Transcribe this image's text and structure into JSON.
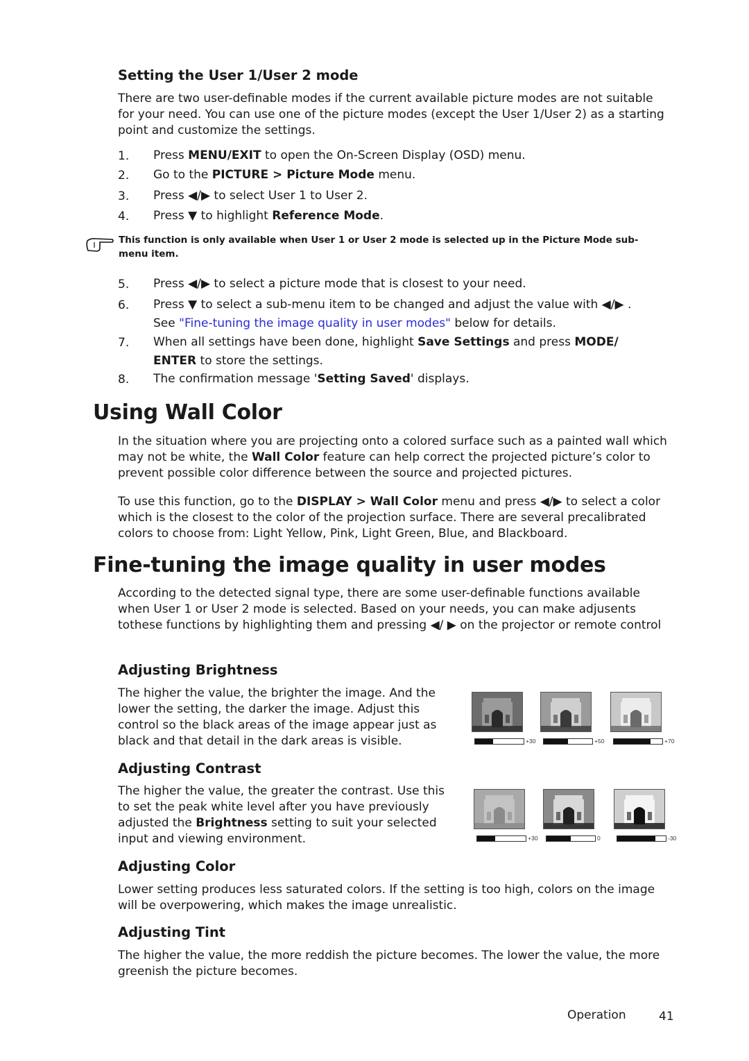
{
  "section1": {
    "heading": "Setting the User 1/User 2 mode",
    "intro": "There are two user-definable modes if the current available picture modes are not suitable for your need. You can use one of the picture modes (except the User 1/User 2) as a starting point and customize the settings.",
    "steps_a": [
      {
        "n": "1.",
        "pre": "Press ",
        "b1": "MENU/EXIT",
        "post": " to open the On-Screen Display (OSD) menu."
      },
      {
        "n": "2.",
        "pre": "Go to the ",
        "b1": "PICTURE > Picture Mode",
        "post": " menu."
      },
      {
        "n": "3.",
        "pre": "Press ◀/▶  to select User 1 to User 2.",
        "b1": "",
        "post": ""
      },
      {
        "n": "4.",
        "pre": "Press ▼  to highlight ",
        "b1": "Reference Mode",
        "post": "."
      }
    ],
    "note": "This function is only available when User 1 or User 2 mode is selected up in the Picture Mode sub-menu item.",
    "steps_b": [
      {
        "n": "5.",
        "text": "Press ◀/▶  to select a picture mode that is closest to your need."
      },
      {
        "n": "6.",
        "text": "Press ▼  to select a sub-menu item to be changed and adjust the value with ◀/▶ .",
        "see_pre": "See ",
        "see_link": "\"Fine-tuning the image quality in user modes\"",
        "see_post": " below for details."
      },
      {
        "n": "7.",
        "pre": "When all settings have been done, highlight ",
        "b1": "Save Settings",
        "mid": " and press ",
        "b2": "MODE/",
        "line2_b": "ENTER",
        "line2_post": " to store the settings."
      },
      {
        "n": "8.",
        "pre": "The confirmation message '",
        "b1": "Setting Saved",
        "post": "' displays."
      }
    ]
  },
  "section2": {
    "heading": "Using Wall Color",
    "p1_pre": "In the situation where you are projecting onto a colored surface such as a painted wall which may not be white, the ",
    "p1_b": "Wall Color",
    "p1_post": " feature can help correct the projected picture’s color to prevent possible color difference between the source and projected pictures.",
    "p2_pre": "To use this function, go to the ",
    "p2_b": "DISPLAY > Wall Color",
    "p2_post": " menu and press ◀/▶  to select a color which is the closest to the color of the projection surface. There are several precalibrated colors to choose from: Light Yellow, Pink, Light Green, Blue, and Blackboard."
  },
  "section3": {
    "heading": "Fine-tuning the image quality in user modes",
    "intro": "According to the detected signal type, there are some user-definable functions available when User 1 or User 2 mode is selected. Based on your needs, you can make adjusents tothese functions by highlighting them and pressing ◀/ ▶ on the projector or remote control",
    "brightness": {
      "heading": "Adjusting Brightness",
      "text": "The higher the value, the brighter the image. And the lower the setting, the darker the image. Adjust this control so the black areas of the image appear just as black and that detail in the dark areas is visible.",
      "samples": [
        {
          "label": "+30",
          "fill": 0.37
        },
        {
          "label": "+50",
          "fill": 0.5
        },
        {
          "label": "+70",
          "fill": 0.76
        }
      ]
    },
    "contrast": {
      "heading": "Adjusting Contrast",
      "text_pre": "The higher the value, the greater the contrast. Use this to set the peak white level after you have previously adjusted the ",
      "text_b": "Brightness",
      "text_post": " setting to suit your selected input and viewing environment.",
      "samples": [
        {
          "label": "+30",
          "fill": 0.37
        },
        {
          "label": "0",
          "fill": 0.5
        },
        {
          "label": "-30",
          "fill": 0.78
        }
      ]
    },
    "color": {
      "heading": "Adjusting Color",
      "text": "Lower setting produces less saturated colors. If the setting is too high, colors on the image will be overpowering, which makes the image unrealistic."
    },
    "tint": {
      "heading": "Adjusting Tint",
      "text": "The higher the value, the more reddish the picture becomes. The lower the value, the more greenish the picture becomes."
    }
  },
  "footer": {
    "section": "Operation",
    "page": "41"
  },
  "colors": {
    "link": "#2b2bd6",
    "text": "#1a1a1a"
  }
}
